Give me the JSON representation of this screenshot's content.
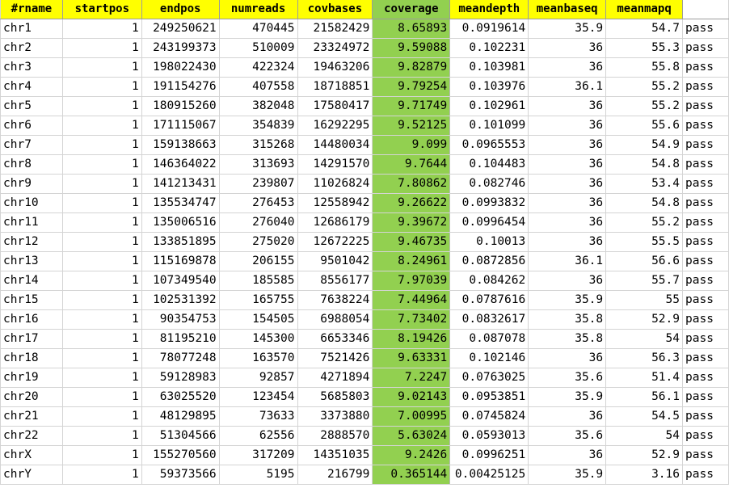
{
  "sheet": {
    "headers": [
      "#rname",
      "startpos",
      "endpos",
      "numreads",
      "covbases",
      "coverage",
      "meandepth",
      "meanbaseq",
      "meanmapq",
      ""
    ],
    "rows": [
      {
        "rname": "chr1",
        "startpos": "1",
        "endpos": "249250621",
        "numreads": "470445",
        "covbases": "21582429",
        "coverage": "8.65893",
        "meandepth": "0.0919614",
        "meanbaseq": "35.9",
        "meanmapq": "54.7",
        "flag": "pass"
      },
      {
        "rname": "chr2",
        "startpos": "1",
        "endpos": "243199373",
        "numreads": "510009",
        "covbases": "23324972",
        "coverage": "9.59088",
        "meandepth": "0.102231",
        "meanbaseq": "36",
        "meanmapq": "55.3",
        "flag": "pass"
      },
      {
        "rname": "chr3",
        "startpos": "1",
        "endpos": "198022430",
        "numreads": "422324",
        "covbases": "19463206",
        "coverage": "9.82879",
        "meandepth": "0.103981",
        "meanbaseq": "36",
        "meanmapq": "55.8",
        "flag": "pass"
      },
      {
        "rname": "chr4",
        "startpos": "1",
        "endpos": "191154276",
        "numreads": "407558",
        "covbases": "18718851",
        "coverage": "9.79254",
        "meandepth": "0.103976",
        "meanbaseq": "36.1",
        "meanmapq": "55.2",
        "flag": "pass"
      },
      {
        "rname": "chr5",
        "startpos": "1",
        "endpos": "180915260",
        "numreads": "382048",
        "covbases": "17580417",
        "coverage": "9.71749",
        "meandepth": "0.102961",
        "meanbaseq": "36",
        "meanmapq": "55.2",
        "flag": "pass"
      },
      {
        "rname": "chr6",
        "startpos": "1",
        "endpos": "171115067",
        "numreads": "354839",
        "covbases": "16292295",
        "coverage": "9.52125",
        "meandepth": "0.101099",
        "meanbaseq": "36",
        "meanmapq": "55.6",
        "flag": "pass"
      },
      {
        "rname": "chr7",
        "startpos": "1",
        "endpos": "159138663",
        "numreads": "315268",
        "covbases": "14480034",
        "coverage": "9.099",
        "meandepth": "0.0965553",
        "meanbaseq": "36",
        "meanmapq": "54.9",
        "flag": "pass"
      },
      {
        "rname": "chr8",
        "startpos": "1",
        "endpos": "146364022",
        "numreads": "313693",
        "covbases": "14291570",
        "coverage": "9.7644",
        "meandepth": "0.104483",
        "meanbaseq": "36",
        "meanmapq": "54.8",
        "flag": "pass"
      },
      {
        "rname": "chr9",
        "startpos": "1",
        "endpos": "141213431",
        "numreads": "239807",
        "covbases": "11026824",
        "coverage": "7.80862",
        "meandepth": "0.082746",
        "meanbaseq": "36",
        "meanmapq": "53.4",
        "flag": "pass"
      },
      {
        "rname": "chr10",
        "startpos": "1",
        "endpos": "135534747",
        "numreads": "276453",
        "covbases": "12558942",
        "coverage": "9.26622",
        "meandepth": "0.0993832",
        "meanbaseq": "36",
        "meanmapq": "54.8",
        "flag": "pass"
      },
      {
        "rname": "chr11",
        "startpos": "1",
        "endpos": "135006516",
        "numreads": "276040",
        "covbases": "12686179",
        "coverage": "9.39672",
        "meandepth": "0.0996454",
        "meanbaseq": "36",
        "meanmapq": "55.2",
        "flag": "pass"
      },
      {
        "rname": "chr12",
        "startpos": "1",
        "endpos": "133851895",
        "numreads": "275020",
        "covbases": "12672225",
        "coverage": "9.46735",
        "meandepth": "0.10013",
        "meanbaseq": "36",
        "meanmapq": "55.5",
        "flag": "pass"
      },
      {
        "rname": "chr13",
        "startpos": "1",
        "endpos": "115169878",
        "numreads": "206155",
        "covbases": "9501042",
        "coverage": "8.24961",
        "meandepth": "0.0872856",
        "meanbaseq": "36.1",
        "meanmapq": "56.6",
        "flag": "pass"
      },
      {
        "rname": "chr14",
        "startpos": "1",
        "endpos": "107349540",
        "numreads": "185585",
        "covbases": "8556177",
        "coverage": "7.97039",
        "meandepth": "0.084262",
        "meanbaseq": "36",
        "meanmapq": "55.7",
        "flag": "pass"
      },
      {
        "rname": "chr15",
        "startpos": "1",
        "endpos": "102531392",
        "numreads": "165755",
        "covbases": "7638224",
        "coverage": "7.44964",
        "meandepth": "0.0787616",
        "meanbaseq": "35.9",
        "meanmapq": "55",
        "flag": "pass"
      },
      {
        "rname": "chr16",
        "startpos": "1",
        "endpos": "90354753",
        "numreads": "154505",
        "covbases": "6988054",
        "coverage": "7.73402",
        "meandepth": "0.0832617",
        "meanbaseq": "35.8",
        "meanmapq": "52.9",
        "flag": "pass"
      },
      {
        "rname": "chr17",
        "startpos": "1",
        "endpos": "81195210",
        "numreads": "145300",
        "covbases": "6653346",
        "coverage": "8.19426",
        "meandepth": "0.087078",
        "meanbaseq": "35.8",
        "meanmapq": "54",
        "flag": "pass"
      },
      {
        "rname": "chr18",
        "startpos": "1",
        "endpos": "78077248",
        "numreads": "163570",
        "covbases": "7521426",
        "coverage": "9.63331",
        "meandepth": "0.102146",
        "meanbaseq": "36",
        "meanmapq": "56.3",
        "flag": "pass"
      },
      {
        "rname": "chr19",
        "startpos": "1",
        "endpos": "59128983",
        "numreads": "92857",
        "covbases": "4271894",
        "coverage": "7.2247",
        "meandepth": "0.0763025",
        "meanbaseq": "35.6",
        "meanmapq": "51.4",
        "flag": "pass"
      },
      {
        "rname": "chr20",
        "startpos": "1",
        "endpos": "63025520",
        "numreads": "123454",
        "covbases": "5685803",
        "coverage": "9.02143",
        "meandepth": "0.0953851",
        "meanbaseq": "35.9",
        "meanmapq": "56.1",
        "flag": "pass"
      },
      {
        "rname": "chr21",
        "startpos": "1",
        "endpos": "48129895",
        "numreads": "73633",
        "covbases": "3373880",
        "coverage": "7.00995",
        "meandepth": "0.0745824",
        "meanbaseq": "36",
        "meanmapq": "54.5",
        "flag": "pass"
      },
      {
        "rname": "chr22",
        "startpos": "1",
        "endpos": "51304566",
        "numreads": "62556",
        "covbases": "2888570",
        "coverage": "5.63024",
        "meandepth": "0.0593013",
        "meanbaseq": "35.6",
        "meanmapq": "54",
        "flag": "pass"
      },
      {
        "rname": "chrX",
        "startpos": "1",
        "endpos": "155270560",
        "numreads": "317209",
        "covbases": "14351035",
        "coverage": "9.2426",
        "meandepth": "0.0996251",
        "meanbaseq": "36",
        "meanmapq": "52.9",
        "flag": "pass"
      },
      {
        "rname": "chrY",
        "startpos": "1",
        "endpos": "59373566",
        "numreads": "5195",
        "covbases": "216799",
        "coverage": "0.365144",
        "meandepth": "0.00425125",
        "meanbaseq": "35.9",
        "meanmapq": "3.16",
        "flag": "pass"
      }
    ]
  },
  "colors": {
    "header_fill": "#ffff00",
    "coverage_fill": "#92d050",
    "gridline": "#d4d4d4"
  }
}
